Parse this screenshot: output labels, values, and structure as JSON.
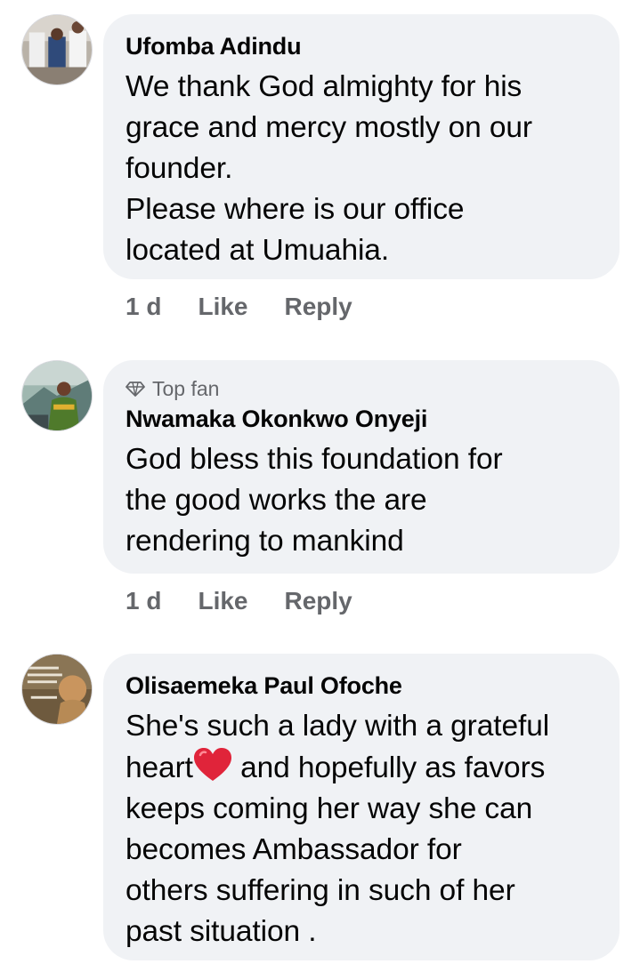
{
  "comments": [
    {
      "author": "Ufomba Adindu",
      "text_lines": [
        "We thank God almighty for his",
        "grace and mercy mostly on our",
        "founder.",
        "Please where is our office",
        "located at Umuahia."
      ],
      "time": "1 d",
      "like_label": "Like",
      "reply_label": "Reply"
    },
    {
      "badge": "Top fan",
      "badge_icon": "diamond-icon",
      "author": "Nwamaka Okonkwo Onyeji",
      "text_lines": [
        "God bless this foundation for",
        "the good works the are",
        "rendering to mankind"
      ],
      "time": "1 d",
      "like_label": "Like",
      "reply_label": "Reply"
    },
    {
      "author": "Olisaemeka Paul Ofoche",
      "text_line_1": "She's such a lady with a grateful",
      "text_line_2_a": "heart",
      "text_line_2_emoji": "red-heart-emoji",
      "text_line_2_b": " and hopefully as favors",
      "text_lines_rest": [
        "keeps coming her way she can",
        "becomes Ambassador for",
        "others suffering in such of her",
        "past situation ."
      ]
    }
  ],
  "colors": {
    "bubble": "#f0f2f5",
    "text": "#050505",
    "meta": "#65676b",
    "heart": "#e0243a"
  }
}
